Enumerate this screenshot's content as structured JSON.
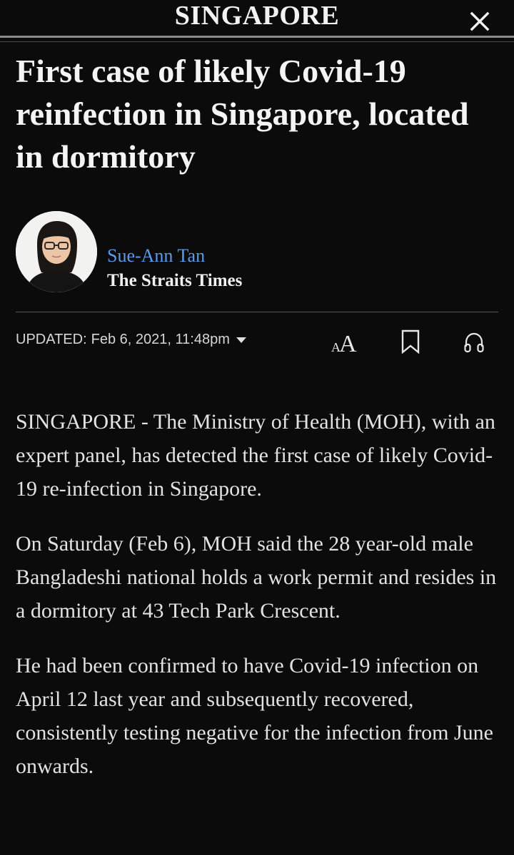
{
  "header": {
    "section": "SINGAPORE",
    "close_icon": "close-icon"
  },
  "article": {
    "headline": "First case of likely Covid-19 reinfection in Singapore, located in dormitory",
    "author": {
      "name": "Sue-Ann Tan",
      "publication": "The Straits Times"
    },
    "meta": {
      "updated_label": "UPDATED:",
      "updated_value": "Feb 6, 2021, 11:48pm",
      "text_size_label": "AA"
    },
    "paragraphs": [
      "SINGAPORE - The Ministry of Health (MOH), with an expert panel, has detected the first case of likely Covid-19 re-infection in Singapore.",
      "On Saturday (Feb 6), MOH said the 28 year-old male Bangladeshi national holds a work permit and resides in a dormitory at 43 Tech Park Crescent.",
      "He had been confirmed to have Covid-19 infection on April 12 last year and subsequently recovered, consistently testing negative for the infection from June onwards."
    ]
  },
  "colors": {
    "background": "#0b0b0b",
    "author_link": "#5b9bea",
    "text": "#e2e2e2"
  }
}
